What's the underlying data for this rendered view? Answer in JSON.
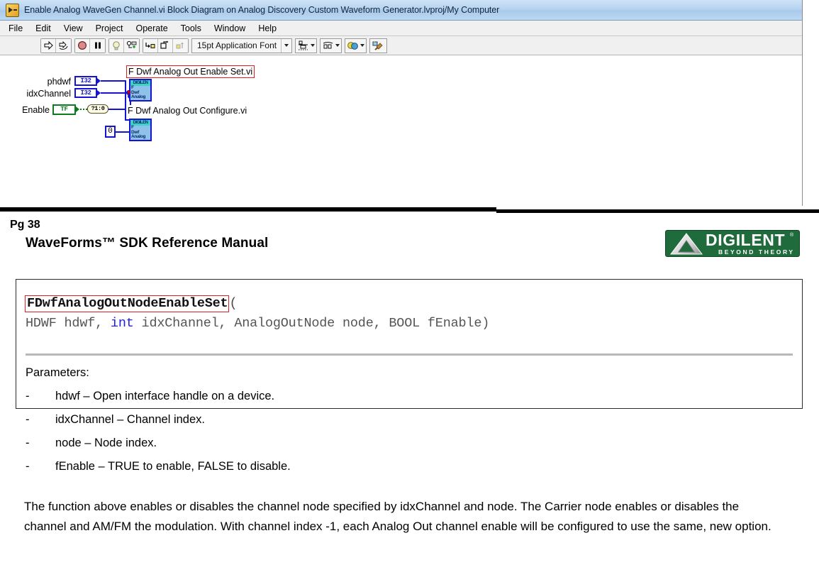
{
  "labview": {
    "title": "Enable Analog WaveGen Channel.vi Block Diagram on Analog Discovery Custom Waveform Generator.lvproj/My Computer",
    "app_icon": "labview-vi-icon",
    "menu": [
      "File",
      "Edit",
      "View",
      "Project",
      "Operate",
      "Tools",
      "Window",
      "Help"
    ],
    "toolbar": {
      "run_icon": "run-arrow-icon",
      "run_continuous_icon": "run-continuously-icon",
      "abort_icon": "abort-execution-icon",
      "pause_icon": "pause-icon",
      "highlight_icon": "highlight-execution-bulb-icon",
      "retain_values_icon": "retain-wire-values-icon",
      "step_into_icon": "step-into-icon",
      "step_over_icon": "step-over-icon",
      "step_out_icon": "step-out-icon",
      "font_label": "15pt Application Font",
      "align_icon": "align-objects-icon",
      "distribute_icon": "distribute-objects-icon",
      "resize_icon": "resize-objects-icon",
      "reorder_icon": "reorder-icon",
      "clean_up_icon": "clean-up-diagram-icon"
    },
    "diagram": {
      "terminals": [
        {
          "name": "phdwf",
          "type": "I32"
        },
        {
          "name": "idxChannel",
          "type": "I32"
        },
        {
          "name": "Enable",
          "type": "TF"
        }
      ],
      "bool_to_num_label": "?1:0",
      "numeric_constant": "0",
      "subvi_icon_header": "DIGILEN",
      "subvi_icon_lines": [
        "F",
        "Dwf",
        "Analog"
      ],
      "subvi_labels": [
        "F Dwf Analog Out Enable Set.vi",
        "F Dwf Analog Out Configure.vi"
      ]
    }
  },
  "document": {
    "page_number": "Pg 38",
    "manual_title": "WaveForms™ SDK Reference Manual",
    "logo": {
      "word": "DIGILENT",
      "registered": "®",
      "tagline": "BEYOND THEORY",
      "icon": "digilent-triangle-icon",
      "background_color": "#1f6b3b"
    },
    "function": {
      "name": "FDwfAnalogOutNodeEnableSet",
      "open_paren": "(",
      "signature_prefix": "HDWF hdwf, ",
      "signature_keyword": "int",
      "signature_suffix": " idxChannel, AnalogOutNode node, BOOL fEnable)",
      "name_border_color": "#e02020",
      "keyword_color": "#2222dd"
    },
    "parameters_heading": "Parameters:",
    "parameters": [
      {
        "bullet": "-",
        "text": "hdwf – Open interface handle on a device."
      },
      {
        "bullet": "-",
        "text": "idxChannel – Channel index."
      },
      {
        "bullet": "-",
        "text": "node – Node index."
      },
      {
        "bullet": "-",
        "text": "fEnable – TRUE to enable, FALSE to disable."
      }
    ],
    "body_text": "The function above enables or disables the channel node specified by idxChannel and node. The Carrier node enables or disables the channel and AM/FM the modulation. With channel index -1, each Analog Out channel enable will be configured to use the same, new option."
  }
}
